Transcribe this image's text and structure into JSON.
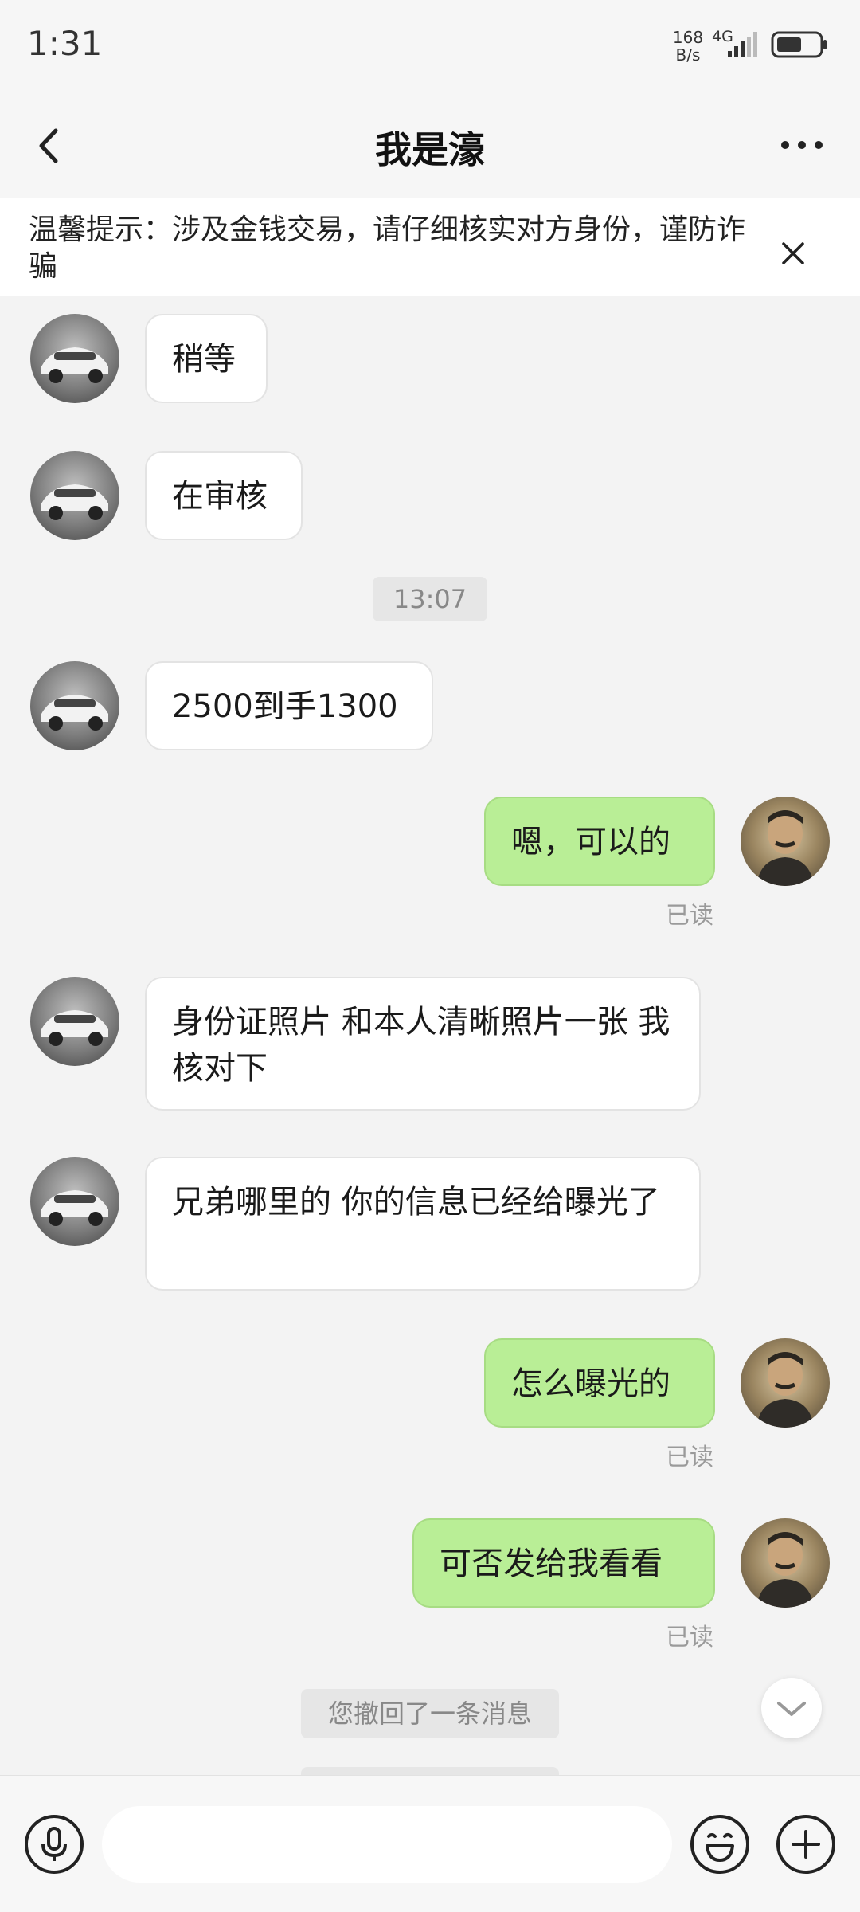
{
  "status_bar": {
    "time": "1:31",
    "net_speed_value": "168",
    "net_speed_unit": "B/s",
    "network_type": "4G"
  },
  "nav": {
    "title": "我是濠"
  },
  "notice": {
    "text": "温馨提示：涉及金钱交易，请仔细核实对方身份，谨防诈骗"
  },
  "chat": {
    "messages": [
      {
        "text": "稍等"
      },
      {
        "text": "在审核"
      },
      {
        "timestamp": "13:07"
      },
      {
        "text": "2500到手1300"
      },
      {
        "text": "嗯，可以的",
        "read": "已读"
      },
      {
        "text": "身份证照片 和本人清晰照片一张  我核对下"
      },
      {
        "text": "兄弟哪里的   你的信息已经给曝光了"
      },
      {
        "text": "怎么曝光的",
        "read": "已读"
      },
      {
        "text": "可否发给我看看",
        "read": "已读"
      },
      {
        "system": "您撤回了一条消息"
      }
    ]
  },
  "input": {
    "placeholder": ""
  },
  "colors": {
    "outgoing_bubble": "#b9ee96",
    "incoming_bubble": "#ffffff",
    "background": "#f3f3f3"
  }
}
